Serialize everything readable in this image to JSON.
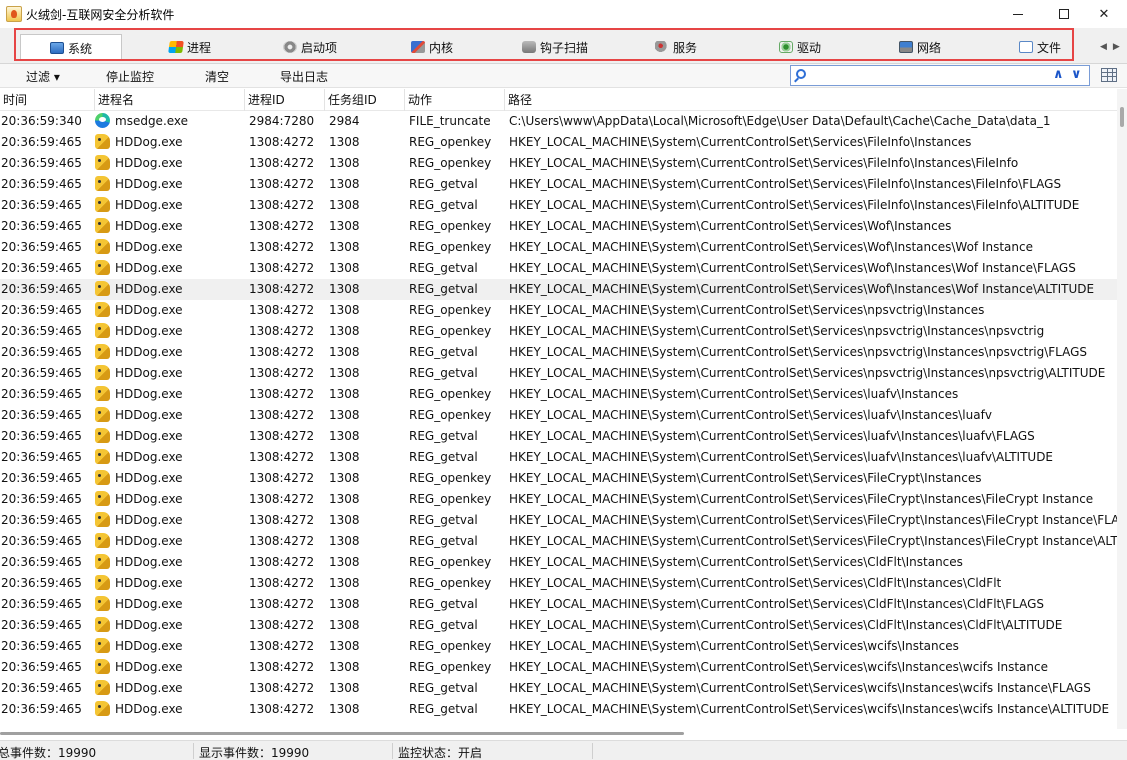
{
  "window": {
    "title": "火绒剑-互联网安全分析软件",
    "minimize_glyph": "—",
    "close_glyph": "✕"
  },
  "tabs": [
    {
      "label": "系统",
      "icon": "system-icon",
      "active": true
    },
    {
      "label": "进程",
      "icon": "process-icon",
      "active": false
    },
    {
      "label": "启动项",
      "icon": "startup-icon",
      "active": false
    },
    {
      "label": "内核",
      "icon": "kernel-icon",
      "active": false
    },
    {
      "label": "钩子扫描",
      "icon": "hook-scan-icon",
      "active": false
    },
    {
      "label": "服务",
      "icon": "service-icon",
      "active": false
    },
    {
      "label": "驱动",
      "icon": "driver-icon",
      "active": false
    },
    {
      "label": "网络",
      "icon": "network-icon",
      "active": false
    },
    {
      "label": "文件",
      "icon": "file-icon",
      "active": false
    }
  ],
  "tab_scroll": {
    "left": "◀",
    "right": "▶"
  },
  "highlight_color": "#e64545",
  "toolbar": {
    "filter_label": "过滤 ▾",
    "stop_label": "停止监控",
    "clear_label": "清空",
    "export_label": "导出日志",
    "search_value": "",
    "search_placeholder": "",
    "prev_glyph": "∧",
    "next_glyph": "∨"
  },
  "table": {
    "columns": [
      "时间",
      "进程名",
      "进程ID",
      "任务组ID",
      "动作",
      "路径"
    ],
    "selected_row_index": 8,
    "rows": [
      {
        "time": "20:36:59:340",
        "process": "msedge.exe",
        "icon": "edge",
        "pid": "2984:7280",
        "tgid": "2984",
        "action": "FILE_truncate",
        "path": "C:\\Users\\www\\AppData\\Local\\Microsoft\\Edge\\User Data\\Default\\Cache\\Cache_Data\\data_1"
      },
      {
        "time": "20:36:59:465",
        "process": "HDDog.exe",
        "icon": "dog",
        "pid": "1308:4272",
        "tgid": "1308",
        "action": "REG_openkey",
        "path": "HKEY_LOCAL_MACHINE\\System\\CurrentControlSet\\Services\\FileInfo\\Instances"
      },
      {
        "time": "20:36:59:465",
        "process": "HDDog.exe",
        "icon": "dog",
        "pid": "1308:4272",
        "tgid": "1308",
        "action": "REG_openkey",
        "path": "HKEY_LOCAL_MACHINE\\System\\CurrentControlSet\\Services\\FileInfo\\Instances\\FileInfo"
      },
      {
        "time": "20:36:59:465",
        "process": "HDDog.exe",
        "icon": "dog",
        "pid": "1308:4272",
        "tgid": "1308",
        "action": "REG_getval",
        "path": "HKEY_LOCAL_MACHINE\\System\\CurrentControlSet\\Services\\FileInfo\\Instances\\FileInfo\\FLAGS"
      },
      {
        "time": "20:36:59:465",
        "process": "HDDog.exe",
        "icon": "dog",
        "pid": "1308:4272",
        "tgid": "1308",
        "action": "REG_getval",
        "path": "HKEY_LOCAL_MACHINE\\System\\CurrentControlSet\\Services\\FileInfo\\Instances\\FileInfo\\ALTITUDE"
      },
      {
        "time": "20:36:59:465",
        "process": "HDDog.exe",
        "icon": "dog",
        "pid": "1308:4272",
        "tgid": "1308",
        "action": "REG_openkey",
        "path": "HKEY_LOCAL_MACHINE\\System\\CurrentControlSet\\Services\\Wof\\Instances"
      },
      {
        "time": "20:36:59:465",
        "process": "HDDog.exe",
        "icon": "dog",
        "pid": "1308:4272",
        "tgid": "1308",
        "action": "REG_openkey",
        "path": "HKEY_LOCAL_MACHINE\\System\\CurrentControlSet\\Services\\Wof\\Instances\\Wof Instance"
      },
      {
        "time": "20:36:59:465",
        "process": "HDDog.exe",
        "icon": "dog",
        "pid": "1308:4272",
        "tgid": "1308",
        "action": "REG_getval",
        "path": "HKEY_LOCAL_MACHINE\\System\\CurrentControlSet\\Services\\Wof\\Instances\\Wof Instance\\FLAGS"
      },
      {
        "time": "20:36:59:465",
        "process": "HDDog.exe",
        "icon": "dog",
        "pid": "1308:4272",
        "tgid": "1308",
        "action": "REG_getval",
        "path": "HKEY_LOCAL_MACHINE\\System\\CurrentControlSet\\Services\\Wof\\Instances\\Wof Instance\\ALTITUDE"
      },
      {
        "time": "20:36:59:465",
        "process": "HDDog.exe",
        "icon": "dog",
        "pid": "1308:4272",
        "tgid": "1308",
        "action": "REG_openkey",
        "path": "HKEY_LOCAL_MACHINE\\System\\CurrentControlSet\\Services\\npsvctrig\\Instances"
      },
      {
        "time": "20:36:59:465",
        "process": "HDDog.exe",
        "icon": "dog",
        "pid": "1308:4272",
        "tgid": "1308",
        "action": "REG_openkey",
        "path": "HKEY_LOCAL_MACHINE\\System\\CurrentControlSet\\Services\\npsvctrig\\Instances\\npsvctrig"
      },
      {
        "time": "20:36:59:465",
        "process": "HDDog.exe",
        "icon": "dog",
        "pid": "1308:4272",
        "tgid": "1308",
        "action": "REG_getval",
        "path": "HKEY_LOCAL_MACHINE\\System\\CurrentControlSet\\Services\\npsvctrig\\Instances\\npsvctrig\\FLAGS"
      },
      {
        "time": "20:36:59:465",
        "process": "HDDog.exe",
        "icon": "dog",
        "pid": "1308:4272",
        "tgid": "1308",
        "action": "REG_getval",
        "path": "HKEY_LOCAL_MACHINE\\System\\CurrentControlSet\\Services\\npsvctrig\\Instances\\npsvctrig\\ALTITUDE"
      },
      {
        "time": "20:36:59:465",
        "process": "HDDog.exe",
        "icon": "dog",
        "pid": "1308:4272",
        "tgid": "1308",
        "action": "REG_openkey",
        "path": "HKEY_LOCAL_MACHINE\\System\\CurrentControlSet\\Services\\luafv\\Instances"
      },
      {
        "time": "20:36:59:465",
        "process": "HDDog.exe",
        "icon": "dog",
        "pid": "1308:4272",
        "tgid": "1308",
        "action": "REG_openkey",
        "path": "HKEY_LOCAL_MACHINE\\System\\CurrentControlSet\\Services\\luafv\\Instances\\luafv"
      },
      {
        "time": "20:36:59:465",
        "process": "HDDog.exe",
        "icon": "dog",
        "pid": "1308:4272",
        "tgid": "1308",
        "action": "REG_getval",
        "path": "HKEY_LOCAL_MACHINE\\System\\CurrentControlSet\\Services\\luafv\\Instances\\luafv\\FLAGS"
      },
      {
        "time": "20:36:59:465",
        "process": "HDDog.exe",
        "icon": "dog",
        "pid": "1308:4272",
        "tgid": "1308",
        "action": "REG_getval",
        "path": "HKEY_LOCAL_MACHINE\\System\\CurrentControlSet\\Services\\luafv\\Instances\\luafv\\ALTITUDE"
      },
      {
        "time": "20:36:59:465",
        "process": "HDDog.exe",
        "icon": "dog",
        "pid": "1308:4272",
        "tgid": "1308",
        "action": "REG_openkey",
        "path": "HKEY_LOCAL_MACHINE\\System\\CurrentControlSet\\Services\\FileCrypt\\Instances"
      },
      {
        "time": "20:36:59:465",
        "process": "HDDog.exe",
        "icon": "dog",
        "pid": "1308:4272",
        "tgid": "1308",
        "action": "REG_openkey",
        "path": "HKEY_LOCAL_MACHINE\\System\\CurrentControlSet\\Services\\FileCrypt\\Instances\\FileCrypt Instance"
      },
      {
        "time": "20:36:59:465",
        "process": "HDDog.exe",
        "icon": "dog",
        "pid": "1308:4272",
        "tgid": "1308",
        "action": "REG_getval",
        "path": "HKEY_LOCAL_MACHINE\\System\\CurrentControlSet\\Services\\FileCrypt\\Instances\\FileCrypt Instance\\FLAGS"
      },
      {
        "time": "20:36:59:465",
        "process": "HDDog.exe",
        "icon": "dog",
        "pid": "1308:4272",
        "tgid": "1308",
        "action": "REG_getval",
        "path": "HKEY_LOCAL_MACHINE\\System\\CurrentControlSet\\Services\\FileCrypt\\Instances\\FileCrypt Instance\\ALTITU"
      },
      {
        "time": "20:36:59:465",
        "process": "HDDog.exe",
        "icon": "dog",
        "pid": "1308:4272",
        "tgid": "1308",
        "action": "REG_openkey",
        "path": "HKEY_LOCAL_MACHINE\\System\\CurrentControlSet\\Services\\CldFlt\\Instances"
      },
      {
        "time": "20:36:59:465",
        "process": "HDDog.exe",
        "icon": "dog",
        "pid": "1308:4272",
        "tgid": "1308",
        "action": "REG_openkey",
        "path": "HKEY_LOCAL_MACHINE\\System\\CurrentControlSet\\Services\\CldFlt\\Instances\\CldFlt"
      },
      {
        "time": "20:36:59:465",
        "process": "HDDog.exe",
        "icon": "dog",
        "pid": "1308:4272",
        "tgid": "1308",
        "action": "REG_getval",
        "path": "HKEY_LOCAL_MACHINE\\System\\CurrentControlSet\\Services\\CldFlt\\Instances\\CldFlt\\FLAGS"
      },
      {
        "time": "20:36:59:465",
        "process": "HDDog.exe",
        "icon": "dog",
        "pid": "1308:4272",
        "tgid": "1308",
        "action": "REG_getval",
        "path": "HKEY_LOCAL_MACHINE\\System\\CurrentControlSet\\Services\\CldFlt\\Instances\\CldFlt\\ALTITUDE"
      },
      {
        "time": "20:36:59:465",
        "process": "HDDog.exe",
        "icon": "dog",
        "pid": "1308:4272",
        "tgid": "1308",
        "action": "REG_openkey",
        "path": "HKEY_LOCAL_MACHINE\\System\\CurrentControlSet\\Services\\wcifs\\Instances"
      },
      {
        "time": "20:36:59:465",
        "process": "HDDog.exe",
        "icon": "dog",
        "pid": "1308:4272",
        "tgid": "1308",
        "action": "REG_openkey",
        "path": "HKEY_LOCAL_MACHINE\\System\\CurrentControlSet\\Services\\wcifs\\Instances\\wcifs Instance"
      },
      {
        "time": "20:36:59:465",
        "process": "HDDog.exe",
        "icon": "dog",
        "pid": "1308:4272",
        "tgid": "1308",
        "action": "REG_getval",
        "path": "HKEY_LOCAL_MACHINE\\System\\CurrentControlSet\\Services\\wcifs\\Instances\\wcifs Instance\\FLAGS"
      },
      {
        "time": "20:36:59:465",
        "process": "HDDog.exe",
        "icon": "dog",
        "pid": "1308:4272",
        "tgid": "1308",
        "action": "REG_getval",
        "path": "HKEY_LOCAL_MACHINE\\System\\CurrentControlSet\\Services\\wcifs\\Instances\\wcifs Instance\\ALTITUDE"
      }
    ]
  },
  "status": {
    "total_events": "总事件数：19990",
    "shown_events": "显示事件数：19990",
    "monitor_state": "监控状态：开启"
  }
}
